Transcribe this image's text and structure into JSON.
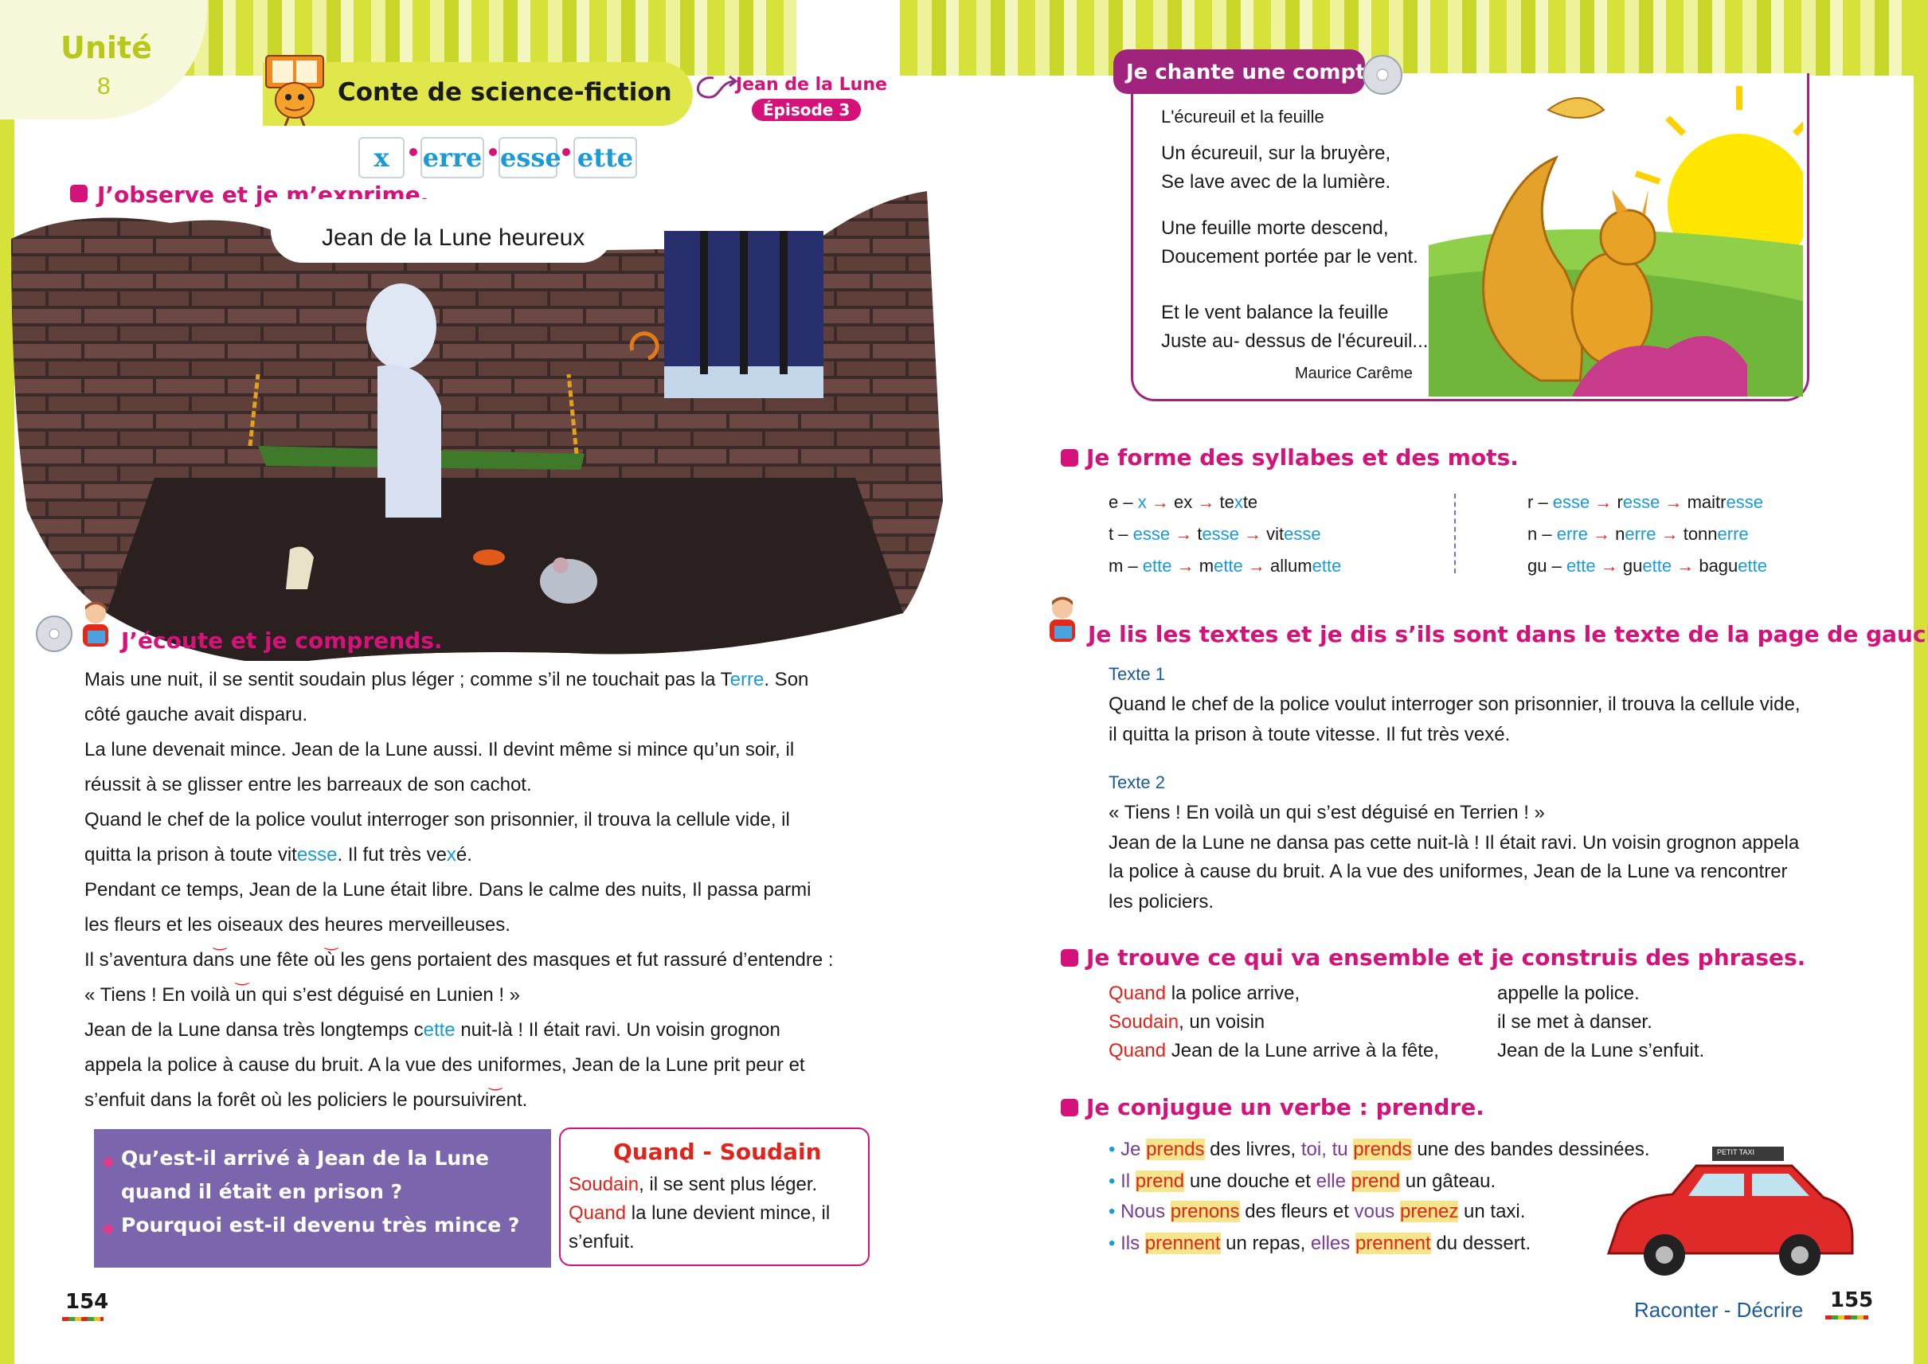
{
  "header": {
    "unit_label": "Unité",
    "unit_number": "8",
    "genre": "Conte de science-fiction",
    "story_title": "Jean de la Lune",
    "episode": "Épisode 3"
  },
  "sound_tiles": [
    "x",
    "erre",
    "esse",
    "ette"
  ],
  "observe": {
    "title": "J’observe et je m’exprime.",
    "picture_caption": "Jean de la Lune heureux"
  },
  "listen": {
    "title": "J’écoute et je comprends.",
    "lines": [
      "Mais une nuit, il se sentit soudain plus léger ; comme s’il ne touchait pas la Terre. Son",
      "côté gauche avait disparu.",
      "La lune devenait mince. Jean de la Lune aussi. Il devint même si mince qu’un soir, il",
      "réussit à se glisser entre les barreaux de son cachot.",
      "Quand le chef de la police voulut interroger son prisonnier, il trouva la cellule vide, il",
      "quitta la prison à toute vitesse. Il fut très vexé.",
      "Pendant ce temps, Jean de la Lune était libre. Dans le calme des nuits, Il passa parmi",
      "les fleurs et les oiseaux des heures merveilleuses.",
      "Il s’aventura dans une fête où les gens portaient des masques et fut rassuré d’entendre :",
      "« Tiens ! En voilà un qui s’est déguisé en Lunien ! »",
      "Jean de la Lune dansa très longtemps cette nuit-là ! Il était ravi. Un voisin grognon",
      "appela la police à cause du bruit. A la vue des uniformes, Jean de la Lune prit peur et",
      "s’enfuit dans la forêt où les policiers le poursuivirent."
    ]
  },
  "questions": [
    "Qu’est-il arrivé à Jean de la Lune",
    "quand il était en prison ?",
    "Pourquoi est-il devenu très mince ?"
  ],
  "quand_soudain": {
    "title": "Quand - Soudain",
    "l1_kw": "Soudain",
    "l1_rest": ", il se sent plus léger.",
    "l2_kw": "Quand",
    "l2_rest": " la lune devient mince, il",
    "l3": "s’enfuit."
  },
  "footer": {
    "page_left": "154",
    "page_right": "155",
    "right_label": "Raconter - Décrire"
  },
  "comptine": {
    "title": "Je chante une comptine",
    "poem_title": "L'écureuil et la feuille",
    "lines": [
      "Un écureuil, sur la bruyère,",
      "Se lave avec de la lumière.",
      "Une feuille morte descend,",
      "Doucement portée par le vent.",
      "Et le vent balance la feuille",
      "Juste au- dessus de l'écureuil..."
    ],
    "author": "Maurice Carême"
  },
  "syllables": {
    "title": "Je forme des syllabes et des mots.",
    "left": [
      [
        "e – ",
        "x",
        "ex",
        "te",
        "x",
        "te"
      ],
      [
        "t – ",
        "esse",
        "t",
        "esse",
        "vit",
        "esse"
      ],
      [
        "m – ",
        "ette",
        "m",
        "ette",
        "allum",
        "ette"
      ]
    ],
    "right": [
      [
        "r – ",
        "esse",
        "r",
        "esse",
        "maitr",
        "esse"
      ],
      [
        "n – ",
        "erre",
        "n",
        "erre",
        "tonn",
        "erre"
      ],
      [
        "gu – ",
        "ette",
        "gu",
        "ette",
        "bagu",
        "ette"
      ]
    ]
  },
  "read_texts": {
    "title": "Je lis les textes et je dis s’ils sont dans le texte de la page de gauche.",
    "texte1_label": "Texte 1",
    "texte1": [
      "Quand le chef de la police voulut interroger son prisonnier, il trouva la cellule vide,",
      "il quitta la prison à toute vitesse. Il fut très vexé."
    ],
    "texte2_label": "Texte 2",
    "texte2": [
      "« Tiens ! En voilà un qui s’est déguisé en Terrien ! »",
      "Jean de la Lune ne dansa pas cette nuit-là ! Il était ravi. Un voisin grognon appela",
      "la police à cause du bruit. A la vue des uniformes, Jean de la Lune va rencontrer",
      "les policiers."
    ]
  },
  "match": {
    "title": "Je trouve ce qui va ensemble et je construis des phrases.",
    "left": [
      {
        "kw": "Quand",
        "rest": " la police arrive,"
      },
      {
        "kw": "Soudain",
        "rest": ", un voisin"
      },
      {
        "kw": "Quand",
        "rest": " Jean de la Lune arrive à la fête,"
      }
    ],
    "right": [
      "appelle la police.",
      "il se met à danser.",
      "Jean de la Lune s’enfuit."
    ]
  },
  "conjugate": {
    "title": "Je conjugue un verbe : prendre.",
    "rows": [
      [
        "Je",
        "prends",
        "des livres,",
        "toi, tu",
        "prends",
        "une des bandes dessinées."
      ],
      [
        "Il",
        "prend",
        "une douche et",
        "elle",
        "prend",
        "un gâteau."
      ],
      [
        "Nous",
        "prenons",
        "des fleurs et",
        "vous",
        "prenez",
        "un taxi."
      ],
      [
        "Ils",
        "prennent",
        "un repas,",
        "elles",
        "prennent",
        "du dessert."
      ]
    ],
    "taxi_sign": "PETIT TAXI"
  },
  "colors": {
    "pink": "#d4127a",
    "blue": "#1a9ad6",
    "red": "#e2231a",
    "purple_box": "#7b66ad",
    "lime": "#cfdc2c"
  },
  "icons": [
    "cd-icon",
    "boy-reading-icon",
    "book-mascot-icon",
    "leaf-icon",
    "sun-icon",
    "squirrel-icon",
    "taxi-icon",
    "cell-illustration"
  ]
}
